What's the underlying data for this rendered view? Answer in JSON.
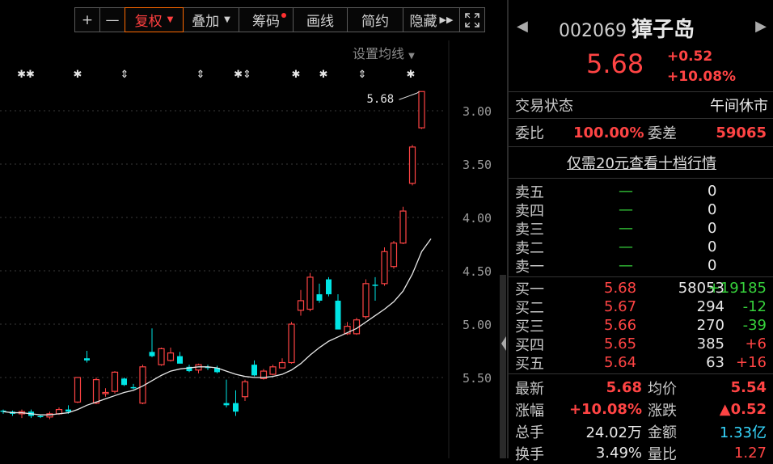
{
  "toolbar": {
    "plus": "+",
    "minus": "—",
    "fuquan": "复权",
    "diejia": "叠加",
    "chouma": "筹码",
    "huaxian": "画线",
    "jianyue": "简约",
    "yincang": "隐藏",
    "fullscreen_icon": "expand-icon"
  },
  "chart": {
    "setting_ma": "设置均线",
    "last_price_label": "5.68",
    "y_ticks": [
      "5.50",
      "5.00",
      "4.50",
      "4.00",
      "3.50",
      "3.00"
    ],
    "markers": [
      "✱✱",
      "✱",
      "⇕",
      "⇕",
      "✱⇕",
      "✱",
      "✱",
      "⇕",
      "✱"
    ]
  },
  "chart_data": {
    "type": "candlestick",
    "ylim": [
      2.6,
      5.85
    ],
    "y_ticks": [
      3.0,
      3.5,
      4.0,
      4.5,
      5.0,
      5.5
    ],
    "candles": [
      {
        "o": 2.69,
        "h": 2.7,
        "l": 2.66,
        "c": 2.68
      },
      {
        "o": 2.68,
        "h": 2.69,
        "l": 2.64,
        "c": 2.66
      },
      {
        "o": 2.66,
        "h": 2.7,
        "l": 2.62,
        "c": 2.68
      },
      {
        "o": 2.68,
        "h": 2.7,
        "l": 2.62,
        "c": 2.64
      },
      {
        "o": 2.64,
        "h": 2.65,
        "l": 2.62,
        "c": 2.63
      },
      {
        "o": 2.63,
        "h": 2.68,
        "l": 2.61,
        "c": 2.66
      },
      {
        "o": 2.66,
        "h": 2.72,
        "l": 2.65,
        "c": 2.7
      },
      {
        "o": 2.7,
        "h": 2.74,
        "l": 2.66,
        "c": 2.68
      },
      {
        "o": 2.77,
        "h": 2.9,
        "l": 2.76,
        "c": 3.0
      },
      {
        "o": 3.18,
        "h": 3.25,
        "l": 3.14,
        "c": 3.16
      },
      {
        "o": 2.76,
        "h": 3.0,
        "l": 2.75,
        "c": 2.98
      },
      {
        "o": 2.85,
        "h": 2.9,
        "l": 2.82,
        "c": 2.86
      },
      {
        "o": 2.87,
        "h": 3.06,
        "l": 2.85,
        "c": 3.05
      },
      {
        "o": 2.99,
        "h": 3.0,
        "l": 2.92,
        "c": 2.93
      },
      {
        "o": 2.91,
        "h": 2.94,
        "l": 2.89,
        "c": 2.9
      },
      {
        "o": 2.76,
        "h": 3.12,
        "l": 2.75,
        "c": 3.1
      },
      {
        "o": 3.24,
        "h": 3.46,
        "l": 3.19,
        "c": 3.2
      },
      {
        "o": 3.12,
        "h": 3.28,
        "l": 3.11,
        "c": 3.27
      },
      {
        "o": 3.16,
        "h": 3.28,
        "l": 3.15,
        "c": 3.23
      },
      {
        "o": 3.2,
        "h": 3.24,
        "l": 3.15,
        "c": 3.13
      },
      {
        "o": 3.1,
        "h": 3.12,
        "l": 3.05,
        "c": 3.06
      },
      {
        "o": 3.07,
        "h": 3.13,
        "l": 3.04,
        "c": 3.12
      },
      {
        "o": 3.1,
        "h": 3.12,
        "l": 3.07,
        "c": 3.09
      },
      {
        "o": 3.09,
        "h": 3.11,
        "l": 3.04,
        "c": 3.05
      },
      {
        "o": 2.76,
        "h": 2.98,
        "l": 2.72,
        "c": 2.74
      },
      {
        "o": 2.76,
        "h": 2.88,
        "l": 2.64,
        "c": 2.68
      },
      {
        "o": 2.82,
        "h": 2.98,
        "l": 2.78,
        "c": 2.96
      },
      {
        "o": 3.12,
        "h": 3.16,
        "l": 3.01,
        "c": 3.02
      },
      {
        "o": 2.99,
        "h": 3.08,
        "l": 2.98,
        "c": 3.06
      },
      {
        "o": 3.03,
        "h": 3.12,
        "l": 3.02,
        "c": 3.1
      },
      {
        "o": 3.09,
        "h": 3.18,
        "l": 3.09,
        "c": 3.14
      },
      {
        "o": 3.14,
        "h": 3.52,
        "l": 3.13,
        "c": 3.5
      },
      {
        "o": 3.63,
        "h": 3.82,
        "l": 3.58,
        "c": 3.72
      },
      {
        "o": 3.64,
        "h": 3.98,
        "l": 3.62,
        "c": 3.94
      },
      {
        "o": 3.78,
        "h": 3.88,
        "l": 3.7,
        "c": 3.72
      },
      {
        "o": 3.92,
        "h": 3.94,
        "l": 3.76,
        "c": 3.78
      },
      {
        "o": 3.72,
        "h": 3.78,
        "l": 3.48,
        "c": 3.45
      },
      {
        "o": 3.41,
        "h": 3.52,
        "l": 3.4,
        "c": 3.48
      },
      {
        "o": 3.41,
        "h": 3.56,
        "l": 3.4,
        "c": 3.54
      },
      {
        "o": 3.57,
        "h": 3.92,
        "l": 3.55,
        "c": 3.88
      },
      {
        "o": 3.87,
        "h": 3.94,
        "l": 3.72,
        "c": 3.86
      },
      {
        "o": 3.88,
        "h": 4.22,
        "l": 3.86,
        "c": 4.18
      },
      {
        "o": 4.04,
        "h": 4.28,
        "l": 4.02,
        "c": 4.26
      },
      {
        "o": 4.26,
        "h": 4.6,
        "l": 4.25,
        "c": 4.56
      },
      {
        "o": 4.82,
        "h": 5.18,
        "l": 4.8,
        "c": 5.16
      },
      {
        "o": 5.34,
        "h": 5.68,
        "l": 5.33,
        "c": 5.68
      }
    ],
    "ma": [
      2.68,
      2.67,
      2.67,
      2.66,
      2.65,
      2.65,
      2.66,
      2.67,
      2.7,
      2.74,
      2.77,
      2.8,
      2.83,
      2.86,
      2.88,
      2.92,
      2.97,
      3.02,
      3.06,
      3.08,
      3.09,
      3.1,
      3.1,
      3.09,
      3.06,
      3.03,
      3.01,
      3.0,
      3.0,
      3.01,
      3.03,
      3.07,
      3.13,
      3.21,
      3.28,
      3.34,
      3.38,
      3.42,
      3.46,
      3.52,
      3.58,
      3.64,
      3.71,
      3.81,
      3.97,
      4.18,
      4.3
    ]
  },
  "panel": {
    "code": "002069",
    "name": "獐子岛",
    "price": "5.68",
    "change": "+0.52",
    "change_pct": "+10.08%",
    "trade_status_label": "交易状态",
    "trade_status": "午间休市",
    "weibi_label": "委比",
    "weibi": "100.00%",
    "weicha_label": "委差",
    "weicha": "59065",
    "link": "仅需20元查看十档行情",
    "asks": [
      {
        "label": "卖五",
        "price": "—",
        "vol": "0"
      },
      {
        "label": "卖四",
        "price": "—",
        "vol": "0"
      },
      {
        "label": "卖三",
        "price": "—",
        "vol": "0"
      },
      {
        "label": "卖二",
        "price": "—",
        "vol": "0"
      },
      {
        "label": "卖一",
        "price": "—",
        "vol": "0"
      }
    ],
    "bids": [
      {
        "label": "买一",
        "price": "5.68",
        "vol": "58053",
        "delta": "+19185"
      },
      {
        "label": "买二",
        "price": "5.67",
        "vol": "294",
        "delta": "-12"
      },
      {
        "label": "买三",
        "price": "5.66",
        "vol": "270",
        "delta": "-39"
      },
      {
        "label": "买四",
        "price": "5.65",
        "vol": "385",
        "delta": "+6"
      },
      {
        "label": "买五",
        "price": "5.64",
        "vol": "63",
        "delta": "+16"
      }
    ],
    "stats": {
      "latest_label": "最新",
      "latest": "5.68",
      "avg_label": "均价",
      "avg": "5.54",
      "pct_label": "涨幅",
      "pct": "+10.08%",
      "diff_label": "涨跌",
      "diff": "▲0.52",
      "hands_label": "总手",
      "hands": "24.02万",
      "amount_label": "金额",
      "amount": "1.33亿",
      "turnover_label": "换手",
      "turnover": "3.49%",
      "vr_label": "量比",
      "vr": "1.27"
    }
  },
  "colors": {
    "up": "#ff4444",
    "down": "#00e5e5",
    "ma": "#e8e8e8",
    "grid": "#3a3a3a"
  }
}
